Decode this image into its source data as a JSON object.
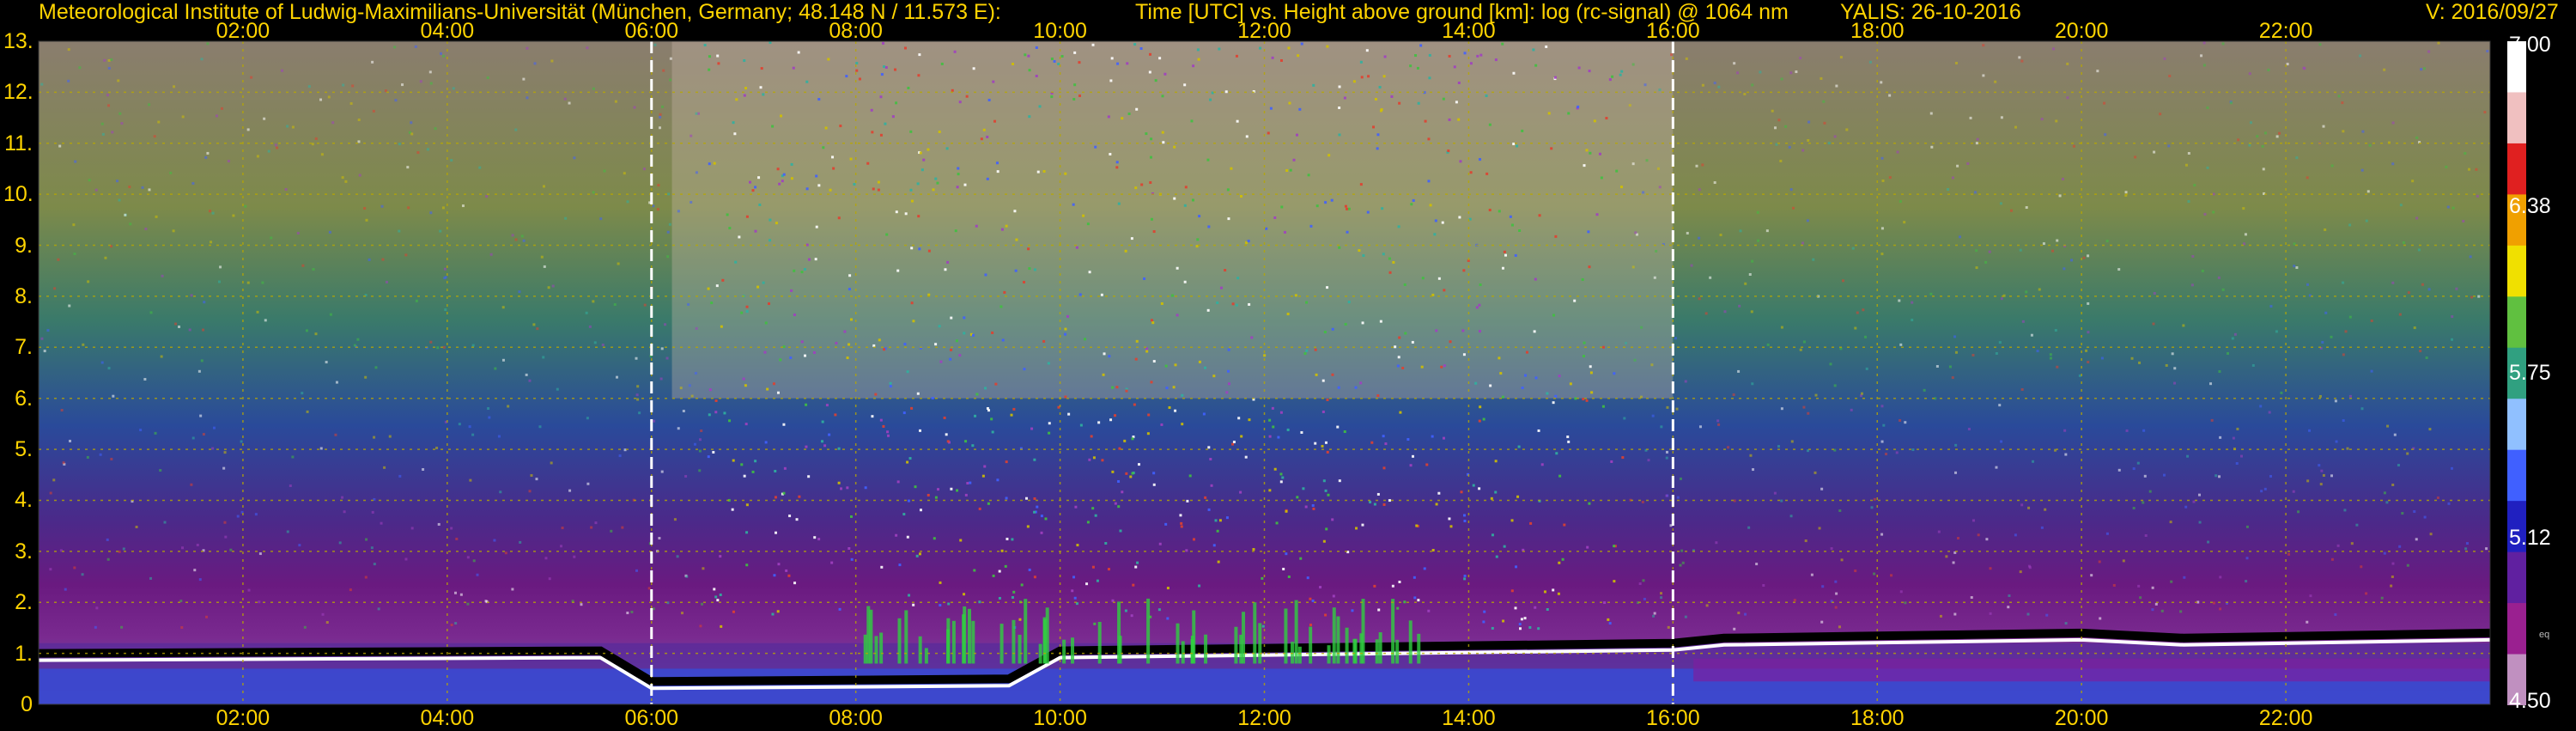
{
  "header": {
    "institute": "Meteorological Institute of Ludwig-Maximilians-Universität (München, Germany; 48.148 N / 11.573 E):",
    "description": "Time [UTC] vs. Height above ground [km]: log (rc-signal) @ 1064 nm",
    "instrument_date": "YALIS: 26-10-2016",
    "version": "V: 2016/09/27"
  },
  "colors": {
    "label_text": "#ffd400",
    "grid": "#b8a800",
    "marker_line": "#ffffff"
  },
  "colorbar": {
    "labels": [
      "7.00",
      "6.38",
      "5.75",
      "5.12",
      "4.50"
    ],
    "min": 4.5,
    "max": 7.0,
    "small_mark": "eq"
  },
  "chart_data": {
    "type": "heatmap",
    "title": "Time [UTC] vs. Height above ground [km]: log (rc-signal) @ 1064 nm",
    "xlabel": "Time [UTC]",
    "ylabel": "Height above ground [km]",
    "x_tick_labels": [
      "02:00",
      "04:00",
      "06:00",
      "08:00",
      "10:00",
      "12:00",
      "14:00",
      "16:00",
      "18:00",
      "20:00",
      "22:00"
    ],
    "x_range_hours": [
      0,
      24
    ],
    "y_tick_labels": [
      "0",
      "1.",
      "2.",
      "3.",
      "4.",
      "5.",
      "6.",
      "7.",
      "8.",
      "9.",
      "10.",
      "11.",
      "12.",
      "13."
    ],
    "y_range_km": [
      0,
      13
    ],
    "vertical_markers_hours": [
      6,
      16
    ],
    "grid": true,
    "colorbar_range": [
      4.5,
      7.0
    ]
  }
}
